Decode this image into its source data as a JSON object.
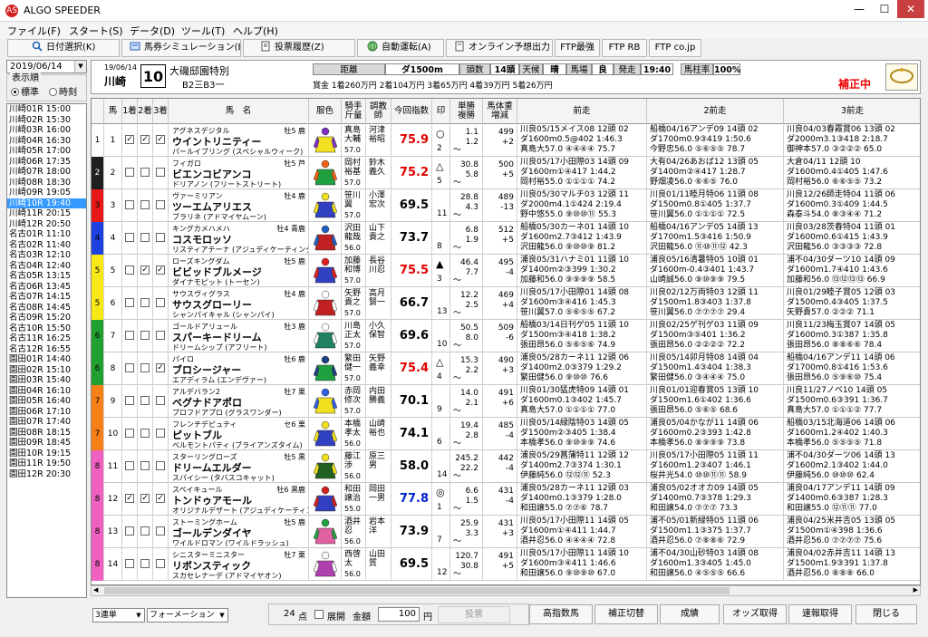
{
  "window": {
    "title": "ALGO SPEEDER",
    "logo": "AS",
    "min_glyph": "—",
    "max_glyph": "☐",
    "close_glyph": "✕"
  },
  "menu": [
    "ファイル(F)",
    "スタート(S)",
    "データ(D)",
    "ツール(T)",
    "ヘルプ(H)"
  ],
  "toolbar": [
    {
      "label": "日付選択(K)",
      "icon": "magnifier-icon"
    },
    {
      "label": "馬券シミュレーション(B)",
      "icon": "ticket-icon"
    },
    {
      "label": "投票履歴(Z)",
      "icon": "document-icon"
    },
    {
      "label": "自動運転(A)",
      "icon": "globe-icon"
    },
    {
      "label": "オンライン予想出力",
      "icon": "document-icon"
    },
    {
      "label": "FTP最強",
      "icon": ""
    },
    {
      "label": "FTP RB",
      "icon": ""
    },
    {
      "label": "FTP co.jp",
      "icon": ""
    }
  ],
  "sidebar": {
    "date": "2019/06/14",
    "order_label": "表示順",
    "order_standard": "標準",
    "order_time": "時刻",
    "races": [
      "川崎01R 15:00",
      "川崎02R 15:30",
      "川崎03R 16:00",
      "川崎04R 16:30",
      "川崎05R 17:00",
      "川崎06R 17:35",
      "川崎07R 18:00",
      "川崎08R 18:30",
      "川崎09R 19:05",
      "川崎10R 19:40",
      "川崎11R 20:15",
      "川崎12R 20:50",
      "名古01R 11:10",
      "名古02R 11:40",
      "名古03R 12:10",
      "名古04R 12:40",
      "名古05R 13:15",
      "名古06R 13:45",
      "名古07R 14:15",
      "名古08R 14:45",
      "名古09R 15:20",
      "名古10R 15:50",
      "名古11R 16:25",
      "名古12R 16:55",
      "園田01R 14:40",
      "園田02R 15:10",
      "園田03R 15:40",
      "園田04R 16:10",
      "園田05R 16:40",
      "園田06R 17:10",
      "園田07R 17:40",
      "園田08R 18:15",
      "園田09R 18:45",
      "園田10R 19:15",
      "園田11R 19:50",
      "園田12R 20:30"
    ],
    "selected_index": 9
  },
  "race": {
    "date": "19/06/14",
    "venue": "川崎",
    "number": "10",
    "name": "大磯邸園特別",
    "class": "B2三B3一",
    "fields": [
      {
        "label": "距離",
        "value": "ダ1500m"
      },
      {
        "label": "頭数",
        "value": "14頭"
      },
      {
        "label": "天候",
        "value": "晴"
      },
      {
        "label": "馬場",
        "value": "良"
      },
      {
        "label": "発走",
        "value": "19:40"
      },
      {
        "label": "馬柱率",
        "value": "100%"
      }
    ],
    "prize": "賞金 1着260万円 2着104万円 3着65万円 4着39万円 5着26万円",
    "correction": "補正中"
  },
  "columns": [
    "",
    "馬",
    "1着",
    "2着",
    "3着",
    "馬　名",
    "服色",
    "騎手\n斤量",
    "調教\n師",
    "今回指数",
    "印",
    "単勝\n複勝",
    "馬体重\n増減",
    "前走",
    "2前走",
    "3前走"
  ],
  "colors": {
    "w1": "#ffffff",
    "w2": "#202020",
    "w3": "#e81818",
    "w4": "#1e40e0",
    "w5": "#f8e818",
    "w6": "#20a030",
    "w7": "#f88018",
    "w8": "#f060c0",
    "idx_red": "#e00000",
    "idx_blue": "#0020d0"
  },
  "horses": [
    {
      "waku": "1",
      "num": "1",
      "c1": true,
      "c2": true,
      "c3": true,
      "sire": "アグネスデジタル",
      "age": "牡5 鹿",
      "name": "ウイントリニティー",
      "dam": "パールイブリング (スペシャルウィーク)",
      "jockey": "真島大輔",
      "weight": "57.0",
      "trainer": "河津裕昭",
      "index": "75.9",
      "idx_color": "red",
      "mark": "○",
      "pop": "2",
      "odds": "1.1",
      "place": "1.2",
      "bw": "499",
      "bwd": "+2",
      "r1": [
        "川良05/15メイス08 12頭 02",
        "ダ1600m0.5@402 1:46.3",
        "真島大57.0 ④④④④ 75.7"
      ],
      "r2": [
        "船橋04/16アンデ09 14頭 02",
        "ダ1700m0.9③419 1:50.6",
        "今野忠56.0 ⑤⑥⑤⑤ 78.7"
      ],
      "r3": [
        "川良04/03春霞賞06 13頭 02",
        "ダ2000m3.1③418 2:18.7",
        "御神本57.0 ③②②② 65.0"
      ]
    },
    {
      "waku": "2",
      "num": "2",
      "c1": false,
      "c2": false,
      "c3": false,
      "sire": "フィガロ",
      "age": "牡5 芦",
      "name": "ビエンコビアンコ",
      "dam": "ドリアノン (フリートストリート)",
      "jockey": "岡村裕基",
      "weight": "57.0",
      "trainer": "鈴木義久",
      "index": "75.2",
      "idx_color": "red",
      "mark": "△",
      "pop": "5",
      "odds": "30.8",
      "place": "5.8",
      "bw": "500",
      "bwd": "+5",
      "r1": [
        "川良05/17小田際03 14頭 09",
        "ダ1600m①④417 1:44.2",
        "岡村裕55.0 ①①①① 74.2"
      ],
      "r2": [
        "大有04/26あおば12 13頭 05",
        "ダ1400m②④417 1:28.7",
        "野畑凌56.0 ⑥⑥⑤ 76.0"
      ],
      "r3": [
        "大倉04/11 12頭 10",
        "ダ1600m0.4①405 1:47.6",
        "岡村裕56.0 ⑥⑥⑤⑤ 73.2"
      ]
    },
    {
      "waku": "3",
      "num": "3",
      "c1": false,
      "c2": false,
      "c3": false,
      "sire": "ヴァーミリアン",
      "age": "牡4 鹿",
      "name": "ツーエムアリエス",
      "dam": "ブラリネ (アドマイヤムーン)",
      "jockey": "笹川翼",
      "weight": "57.0",
      "trainer": "小澤宏次",
      "index": "69.5",
      "idx_color": "black",
      "mark": "",
      "pop": "11",
      "odds": "28.8",
      "place": "4.3",
      "bw": "489",
      "bwd": "-13",
      "r1": [
        "川良05/30マルチ03 12頭 11",
        "ダ2000m4.1①424 2:19.4",
        "野中悠55.0 ⑨⑩⑩⑪ 55.3"
      ],
      "r2": [
        "川良01/11睦月特06 11頭 08",
        "ダ1500m0.8①405 1:37.7",
        "笹川翼56.0 ①①①① 72.5"
      ],
      "r3": [
        "川良12/26師走特04 11頭 06",
        "ダ1600m0.3①409 1:44.5",
        "森泰斗54.0 ⑧③④④ 71.2"
      ]
    },
    {
      "waku": "4",
      "num": "4",
      "c1": false,
      "c2": false,
      "c3": false,
      "sire": "キングカメハメハ",
      "age": "牡4 青鹿",
      "name": "コスモロッソ",
      "dam": "リスティアテーナ (アジュディケーティング)",
      "jockey": "沢田龍哉",
      "weight": "56.0",
      "trainer": "山下貴之",
      "index": "73.7",
      "idx_color": "black",
      "mark": "",
      "pop": "8",
      "odds": "6.8",
      "place": "1.9",
      "bw": "512",
      "bwd": "+5",
      "r1": [
        "船橋05/30カーネ01 14頭 10",
        "ダ1600m2.7③412 1:43.9",
        "沢田龍56.0 ⑨⑩⑩⑨ 81.2"
      ],
      "r2": [
        "船橋04/16アンデ05 14頭 13",
        "ダ1700m1.5③416 1:50.9",
        "沢田龍56.0 ⑪⑩⑪⑫ 42.3"
      ],
      "r3": [
        "川良03/28茨春特04 11頭 01",
        "ダ1600m0.6①415 1:43.9",
        "沢田龍56.0 ③③③③ 72.8"
      ]
    },
    {
      "waku": "5",
      "num": "5",
      "c1": false,
      "c2": true,
      "c3": true,
      "sire": "ローズキングダム",
      "age": "牡5 鹿",
      "name": "ビビッドブルメージ",
      "dam": "ダイナモピット (トーセン)",
      "jockey": "加藤和博",
      "weight": "57.0",
      "trainer": "長谷川忍",
      "index": "75.5",
      "idx_color": "red",
      "mark": "▲",
      "pop": "3",
      "odds": "46.4",
      "place": "7.7",
      "bw": "495",
      "bwd": "-4",
      "r1": [
        "浦良05/31ハナミ01 11頭 10",
        "ダ1400m②③399 1:30.2",
        "加藤和56.0 ⑨⑨⑨⑨ 58.5"
      ],
      "r2": [
        "浦良05/16清暑特05 10頭 01",
        "ダ1600m-0.4③401 1:43.7",
        "山崎誠56.0 ⑨⑩⑨⑨ 79.5"
      ],
      "r3": [
        "浦不04/30ダーツ10 14頭 09",
        "ダ1600m1.7④410 1:43.6",
        "加藤和56.0 ⑬⑫⑬⑬ 66.9"
      ]
    },
    {
      "waku": "5",
      "num": "6",
      "c1": false,
      "c2": false,
      "c3": false,
      "sire": "サウスヴィグラス",
      "age": "牡4 鹿",
      "name": "サウスグローリー",
      "dam": "シャンパイキャル (シャンパイ)",
      "jockey": "矢野貴之",
      "weight": "57.0",
      "trainer": "高月賢一",
      "index": "66.7",
      "idx_color": "black",
      "mark": "",
      "pop": "13",
      "odds": "12.2",
      "place": "2.5",
      "bw": "469",
      "bwd": "+4",
      "r1": [
        "川良05/17小田際01 14頭 08",
        "ダ1600m③④416 1:45.3",
        "笹川翼57.0 ⑤⑥⑤⑤ 67.2"
      ],
      "r2": [
        "川良02/12万両特03 12頭 11",
        "ダ1500m1.8③403 1:37.8",
        "笹川翼56.0 ⑦⑦⑦⑦ 29.4"
      ],
      "r3": [
        "川良01/29睦子賞05 12頭 03",
        "ダ1500m0.4③405 1:37.5",
        "矢野貴57.0 ②②② 71.1"
      ]
    },
    {
      "waku": "6",
      "num": "7",
      "c1": false,
      "c2": false,
      "c3": false,
      "sire": "ゴールドアリュール",
      "age": "牡3 鹿",
      "name": "スパーキードリーム",
      "dam": "ドリームシップ (アフリート)",
      "jockey": "川島正太",
      "weight": "57.0",
      "trainer": "小久保智",
      "index": "69.6",
      "idx_color": "black",
      "mark": "",
      "pop": "10",
      "odds": "50.5",
      "place": "8.0",
      "bw": "509",
      "bwd": "-6",
      "r1": [
        "船橋03/14日刊ゲ05 11頭 10",
        "ダ1500m③④418 1:38.2",
        "張田昂56.0 ⑤⑥⑤⑥ 74.9"
      ],
      "r2": [
        "川良02/25ゲ刊ゲ03 11頭 09",
        "ダ1500m③⑤401 1:36.2",
        "張田昂56.0 ②②②② 72.2"
      ],
      "r3": [
        "川良11/23梅玉賞07 14頭 05",
        "ダ1600m0.3①387 1:35.8",
        "張田昂56.0 ⑧⑧⑥⑥ 78.4"
      ]
    },
    {
      "waku": "6",
      "num": "8",
      "c1": false,
      "c2": false,
      "c3": true,
      "sire": "パイロ",
      "age": "牡6 鹿",
      "name": "ブロシージャー",
      "dam": "エアディラム (エンデヴァー)",
      "jockey": "繁田健一",
      "weight": "57.0",
      "trainer": "矢野義幸",
      "index": "75.4",
      "idx_color": "red",
      "mark": "△",
      "pop": "4",
      "odds": "15.3",
      "place": "2.2",
      "bw": "490",
      "bwd": "+3",
      "r1": [
        "浦良05/28カーネ11 12頭 06",
        "ダ1400m2.0③379 1:29.2",
        "繁田健56.0 ⑨⑩⑩ 76.6"
      ],
      "r2": [
        "川良05/14卯月特08 14頭 04",
        "ダ1500m1.4③404 1:38.3",
        "繁田健56.0 ③④④④ 75.0"
      ],
      "r3": [
        "船橋04/16アンデ11 14頭 06",
        "ダ1700m0.8①416 1:53.6",
        "張田昂56.0 ⑤⑨⑥⑩ 75.4"
      ]
    },
    {
      "waku": "7",
      "num": "9",
      "c1": false,
      "c2": false,
      "c3": false,
      "sire": "アルデバラン2",
      "age": "牡7 栗",
      "name": "ベグナドアポロ",
      "dam": "プロフドアプロ (グラスワンダー)",
      "jockey": "赤岡修次",
      "weight": "57.0",
      "trainer": "内田勝義",
      "index": "70.1",
      "idx_color": "black",
      "mark": "",
      "pop": "9",
      "odds": "14.0",
      "place": "2.1",
      "bw": "491",
      "bwd": "+6",
      "r1": [
        "川良01/30猛虎特09 14頭 01",
        "ダ1600m0.1③402 1:45.7",
        "真島大57.0 ①①①① 77.0"
      ],
      "r2": [
        "川良01/01迎春賞05 13頭 10",
        "ダ1500m1.6①402 1:36.6",
        "張田昂56.0 ⑤⑥⑤ 68.6"
      ],
      "r3": [
        "川良11/27ノベ10 14頭 05",
        "ダ1500m0.6③391 1:36.7",
        "真島大57.0 ①①①② 77.7"
      ]
    },
    {
      "waku": "7",
      "num": "10",
      "c1": false,
      "c2": false,
      "c3": false,
      "sire": "フレンチデピュティ",
      "age": "セ6 栗",
      "name": "ピットブル",
      "dam": "ベルモントパティ (ブライアンズタイム)",
      "jockey": "本橋孝太",
      "weight": "56.0",
      "trainer": "山崎裕也",
      "index": "74.1",
      "idx_color": "black",
      "mark": "",
      "pop": "6",
      "odds": "19.4",
      "place": "2.8",
      "bw": "485",
      "bwd": "-4",
      "r1": [
        "川良05/14緑陰特03 14頭 05",
        "ダ1500m②③405 1:38.4",
        "本橋孝56.0 ⑨⑩⑨⑨ 74.6"
      ],
      "r2": [
        "浦良05/04かなが11 14頭 06",
        "ダ1600m0.2③393 1:42.8",
        "本橋孝56.0 ⑧⑨⑨⑨ 73.8"
      ],
      "r3": [
        "船橋03/15北海道06 14頭 06",
        "ダ1600m1.2④402 1:40.3",
        "本橋孝56.0 ⑤⑤⑤⑤ 71.8"
      ]
    },
    {
      "waku": "8",
      "num": "11",
      "c1": false,
      "c2": false,
      "c3": false,
      "sire": "スターリングローズ",
      "age": "牡5 黒",
      "name": "ドリームエルダー",
      "dam": "スパイシー (タバスコキャット)",
      "jockey": "藤江渉",
      "weight": "56.0",
      "trainer": "原三男",
      "index": "58.0",
      "idx_color": "black",
      "mark": "",
      "pop": "14",
      "odds": "245.2",
      "place": "22.2",
      "bw": "442",
      "bwd": "-4",
      "r1": [
        "浦良05/29菖蒲特11 12頭 12",
        "ダ1400m2.7③374 1:30.1",
        "伊藤純56.0 ⑫⑫⑪ 52.3"
      ],
      "r2": [
        "川良05/17小田際05 11頭 11",
        "ダ1600m1.2③407 1:46.1",
        "桜井光54.0 ⑩⑩⑪⑪ 58.9"
      ],
      "r3": [
        "浦不04/30ダーツ06 14頭 13",
        "ダ1600m2.1③402 1:44.0",
        "伊藤純56.0 ⑩⑩⑩ 62.4"
      ]
    },
    {
      "waku": "8",
      "num": "12",
      "c1": true,
      "c2": true,
      "c3": true,
      "sire": "スペイキュール",
      "age": "牡6 黒鹿",
      "name": "トンドゥアモール",
      "dam": "オリジナルデザート (アジュディケーティング)",
      "jockey": "和田譲治",
      "weight": "55.0",
      "trainer": "岡田一男",
      "index": "77.8",
      "idx_color": "blue",
      "mark": "◎",
      "pop": "1",
      "odds": "6.6",
      "place": "1.5",
      "bw": "431",
      "bwd": "-4",
      "r1": [
        "浦良05/28カーネ11 12頭 03",
        "ダ1400m0.1③379 1:28.0",
        "和田譲55.0 ⑦⑦⑥ 78.7"
      ],
      "r2": [
        "浦良05/02オオカ09 14頭 05",
        "ダ1400m0.7③378 1:29.3",
        "和田譲54.0 ⑦⑦⑦ 73.3"
      ],
      "r3": [
        "浦良04/17アンデ11 14頭 09",
        "ダ1400m0.6③387 1:28.3",
        "和田譲55.0 ⑫⑪⑪ 77.0"
      ]
    },
    {
      "waku": "8",
      "num": "13",
      "c1": false,
      "c2": false,
      "c3": false,
      "sire": "ストーミングホーム",
      "age": "牡5 鹿",
      "name": "ゴールデンダイヤ",
      "dam": "ワイルドロマン (ワイルドラッシュ)",
      "jockey": "酒井忍",
      "weight": "56.0",
      "trainer": "岩本洋",
      "index": "73.9",
      "idx_color": "black",
      "mark": "",
      "pop": "7",
      "odds": "25.9",
      "place": "3.3",
      "bw": "431",
      "bwd": "+3",
      "r1": [
        "川良05/17小田際11 14頭 05",
        "ダ1600m①④411 1:44.7",
        "酒井忍56.0 ④④④④ 72.8"
      ],
      "r2": [
        "浦不05/01新緑特05 11頭 06",
        "ダ1500m1.1③375 1:37.7",
        "酒井忍56.0 ⑦⑧⑧⑥ 72.9"
      ],
      "r3": [
        "浦良04/25米井吉05 13頭 05",
        "ダ1500m①④398 1:36.6",
        "酒井忍56.0 ⑦⑦⑦⑦ 75.6"
      ]
    },
    {
      "waku": "8",
      "num": "14",
      "c1": false,
      "c2": false,
      "c3": false,
      "sire": "シニスターミニスター",
      "age": "牡7 栗",
      "name": "リボンスティック",
      "dam": "スカセレナーデ (アドマイヤオン)",
      "jockey": "西啓太",
      "weight": "56.0",
      "trainer": "山田質",
      "index": "69.5",
      "idx_color": "black",
      "mark": "",
      "pop": "12",
      "odds": "120.7",
      "place": "30.8",
      "bw": "491",
      "bwd": "+5",
      "r1": [
        "川良05/17小田際11 14頭 10",
        "ダ1600m③④411 1:46.6",
        "和田譲56.0 ⑨⑩⑨⑩ 67.0"
      ],
      "r2": [
        "浦不04/30山砂特03 14頭 08",
        "ダ1600m1.3③405 1:45.0",
        "和田譲56.0 ④⑤⑤⑤ 66.6"
      ],
      "r3": [
        "浦良04/02赤井吉11 14頭 13",
        "ダ1500m1.9③391 1:37.8",
        "酒井忍56.0 ⑧⑧⑧ 66.0"
      ]
    }
  ],
  "bottom": {
    "bet_type": "3連単",
    "bet_mode": "フォーメーション",
    "points": "24",
    "points_unit": "点",
    "expand_label": "展開",
    "amount_label": "金額",
    "amount": "100",
    "yen": "円",
    "vote_label": "投票",
    "buttons": [
      "高指数馬",
      "補正切替",
      "成績",
      "オッズ取得",
      "速報取得",
      "閉じる"
    ]
  }
}
